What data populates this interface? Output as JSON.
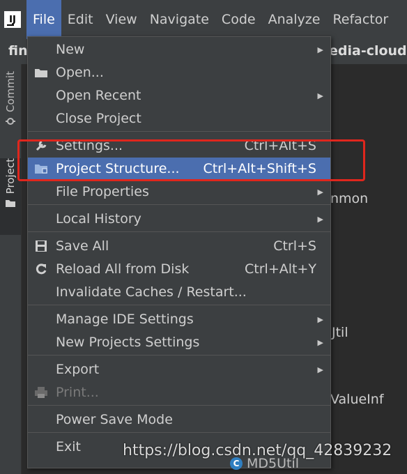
{
  "app": {
    "logo_text": "IJ"
  },
  "menubar": {
    "items": [
      {
        "label": "File",
        "active": true
      },
      {
        "label": "Edit"
      },
      {
        "label": "View"
      },
      {
        "label": "Navigate"
      },
      {
        "label": "Code"
      },
      {
        "label": "Analyze"
      },
      {
        "label": "Refactor"
      }
    ]
  },
  "breadcrumb": {
    "left": "fin",
    "right": "edia-cloud-"
  },
  "sidebar": {
    "tabs": [
      {
        "label": "Commit"
      },
      {
        "label": "Project"
      }
    ]
  },
  "background_text": {
    "common": "nmon",
    "util": "Jtil",
    "valueinf": "ValueInf",
    "md5util": "MD5Util"
  },
  "file_menu": {
    "items": [
      {
        "label": "New",
        "submenu": true
      },
      {
        "label": "Open...",
        "icon": "folder-icon"
      },
      {
        "label": "Open Recent",
        "submenu": true
      },
      {
        "label": "Close Project"
      },
      {
        "label": "Settings...",
        "shortcut": "Ctrl+Alt+S",
        "icon": "wrench-icon"
      },
      {
        "label": "Project Structure...",
        "shortcut": "Ctrl+Alt+Shift+S",
        "icon": "project-structure-icon",
        "selected": true
      },
      {
        "label": "File Properties",
        "submenu": true
      },
      {
        "label": "Local History",
        "submenu": true
      },
      {
        "label": "Save All",
        "shortcut": "Ctrl+S",
        "icon": "save-icon"
      },
      {
        "label": "Reload All from Disk",
        "shortcut": "Ctrl+Alt+Y",
        "icon": "reload-icon"
      },
      {
        "label": "Invalidate Caches / Restart..."
      },
      {
        "label": "Manage IDE Settings",
        "submenu": true
      },
      {
        "label": "New Projects Settings",
        "submenu": true
      },
      {
        "label": "Export",
        "submenu": true
      },
      {
        "label": "Print...",
        "icon": "print-icon",
        "disabled": true
      },
      {
        "label": "Power Save Mode"
      },
      {
        "label": "Exit"
      }
    ]
  },
  "watermark": "https://blog.csdn.net/qq_42839232"
}
